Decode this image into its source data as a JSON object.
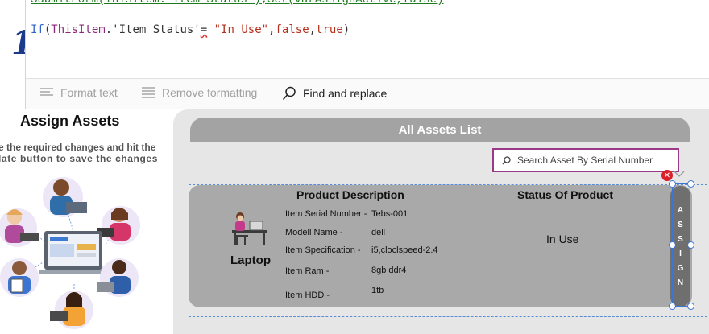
{
  "formula": {
    "previous_line": "SubmitForm(ThisItem.'Item Status');Set(varAssignActive,false)",
    "fn": "If",
    "open": "(",
    "context": "ThisItem",
    "dot_field": ".'Item Status'",
    "eq": "=",
    "str": " \"In Use\"",
    "rest1": ",",
    "kw1": "false",
    "rest2": ",",
    "kw2": "true",
    "close": ")"
  },
  "toolbar": {
    "format_text": "Format text",
    "remove_formatting": "Remove formatting",
    "find_replace": "Find and replace"
  },
  "left": {
    "title": "Assign Assets",
    "desc_line1": "e the required changes and hit the",
    "desc_line2": "late button to save the changes"
  },
  "main": {
    "header": "All Assets List",
    "search_placeholder": "Search Asset By Serial Number"
  },
  "item": {
    "product_description_header": "Product Description",
    "status_header": "Status Of Product",
    "category": "Laptop",
    "labels": {
      "serial": "Item Serial Number -",
      "model": "Modell Name -",
      "spec": "Item Specification -",
      "ram": "Item Ram -",
      "hdd": "Item HDD -"
    },
    "values": {
      "serial": "Tebs-001",
      "model": "dell",
      "spec": "i5,cloclspeed-2.4",
      "ram": "8gb ddr4",
      "hdd": "1tb"
    },
    "status": "In Use",
    "assign_letters": [
      "A",
      "S",
      "S",
      "I",
      "G",
      "N"
    ]
  },
  "colors": {
    "header_bar": "#a3a3a3",
    "card": "#a9a9a9",
    "assign_button": "#6f6f6f",
    "search_border": "#9b3a88",
    "selection": "#3b74d1",
    "error": "#d9202a"
  }
}
